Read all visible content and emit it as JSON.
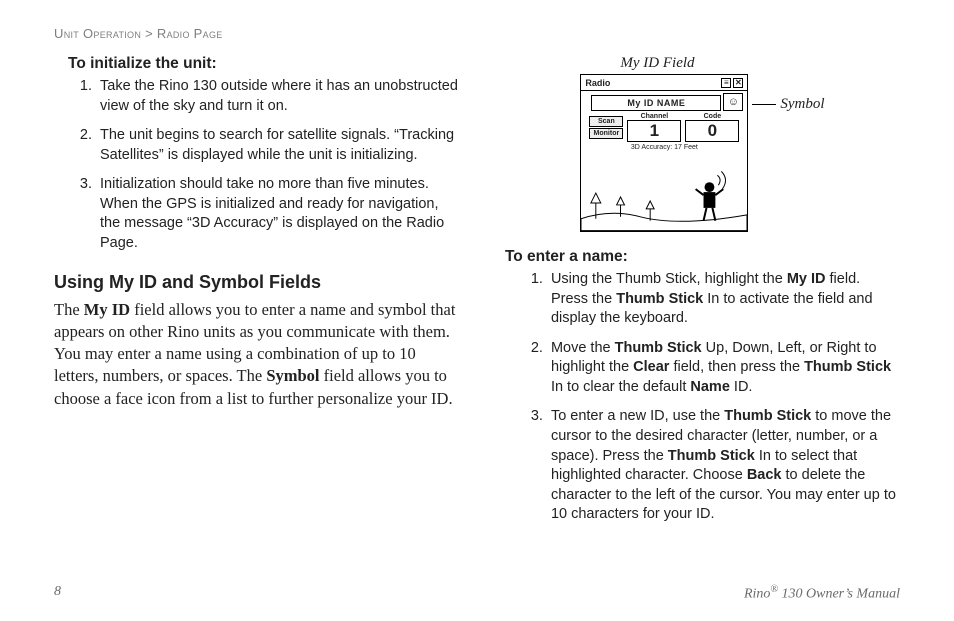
{
  "breadcrumb": {
    "section": "Unit Operation",
    "sep": " > ",
    "page": "Radio Page"
  },
  "left": {
    "init_head": "To initialize the unit:",
    "init_steps": [
      "Take the Rino 130 outside where it has an unobstructed view of the sky and turn it on.",
      "The unit begins to search for satellite signals. “Tracking Satellites” is displayed while the unit is initializing.",
      "Initialization should take no more than five minutes. When the GPS is initialized and ready for navigation, the message “3D Accuracy” is displayed on the Radio Page."
    ],
    "section_head": "Using My ID and Symbol Fields",
    "para_pre": "The ",
    "para_b1": "My ID",
    "para_mid1": " field allows you to enter a name and symbol that appears on other Rino units as you communicate with them. You may enter a name using a combination of up to 10 letters, numbers, or spaces. The ",
    "para_b2": "Symbol",
    "para_end": " field allows you to choose a face icon from a list to further personalize your ID."
  },
  "right": {
    "fig_top_label": "My ID Field",
    "fig_symbol_label": "Symbol",
    "device": {
      "title": "Radio",
      "id_label": "My ID NAME",
      "symbol_face": "☺",
      "btn_scan": "Scan",
      "btn_monitor": "Monitor",
      "ch_label": "Channel",
      "code_label": "Code",
      "channel": "1",
      "code": "0",
      "accuracy": "3D Accuracy: 17 Feet",
      "menu_glyph": "≡",
      "close_glyph": "✕"
    },
    "enter_head": "To enter a name:",
    "enter_steps": [
      {
        "pre": "Using the Thumb Stick, highlight the ",
        "b1": "My ID",
        "mid": " field. Press the ",
        "b2": "Thumb Stick",
        "post": " In to activate the field and display the keyboard."
      },
      {
        "pre": "Move the ",
        "b1": "Thumb Stick",
        "mid": " Up, Down, Left, or Right to highlight the ",
        "b2": "Clear",
        "mid2": " field, then press the ",
        "b3": "Thumb Stick",
        "mid3": " In to clear the default ",
        "b4": "Name",
        "post": " ID."
      },
      {
        "pre": "To enter a new ID, use the ",
        "b1": "Thumb Stick",
        "mid": " to move the cursor to the desired character (letter, number, or a space). Press the ",
        "b2": "Thumb Stick",
        "mid2": " In to select that highlighted character. Choose ",
        "b3": "Back",
        "post": " to delete the character to the left of the cursor. You may enter up to 10 characters for your ID."
      }
    ]
  },
  "footer": {
    "page_num": "8",
    "product_pre": "Rino",
    "product_reg": "®",
    "product_post": " 130 Owner’s Manual"
  }
}
